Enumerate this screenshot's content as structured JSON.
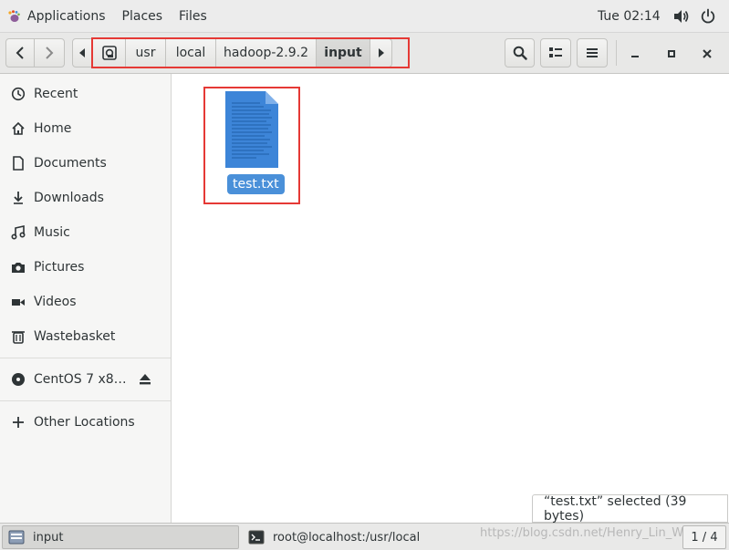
{
  "topbar": {
    "applications": "Applications",
    "places": "Places",
    "files": "Files",
    "clock": "Tue 02:14",
    "volume_icon": "speaker-icon",
    "power_icon": "power-icon"
  },
  "path_bar": {
    "crumbs": [
      "usr",
      "local",
      "hadoop-2.9.2",
      "input"
    ],
    "current": "input"
  },
  "sidebar": {
    "items": [
      {
        "label": "Recent",
        "icon": "clock-icon"
      },
      {
        "label": "Home",
        "icon": "home-icon"
      },
      {
        "label": "Documents",
        "icon": "document-icon"
      },
      {
        "label": "Downloads",
        "icon": "download-icon"
      },
      {
        "label": "Music",
        "icon": "music-icon"
      },
      {
        "label": "Pictures",
        "icon": "camera-icon"
      },
      {
        "label": "Videos",
        "icon": "video-icon"
      },
      {
        "label": "Wastebasket",
        "icon": "trash-icon"
      }
    ],
    "device": {
      "label": "CentOS 7 x8…",
      "icon": "disc-icon"
    },
    "other": {
      "label": "Other Locations",
      "icon": "plus-icon"
    }
  },
  "content": {
    "file_name": "test.txt"
  },
  "status": {
    "selection": "“test.txt” selected  (39 bytes)"
  },
  "taskbar": {
    "window1": "input",
    "window2": "root@localhost:/usr/local",
    "watermark": "https://blog.csdn.net/Henry_Lin_Wind",
    "pager": "1 / 4"
  },
  "colors": {
    "selection": "#4a90d9",
    "annotation_red": "#e53935",
    "file_icon": "#3d85d8"
  }
}
